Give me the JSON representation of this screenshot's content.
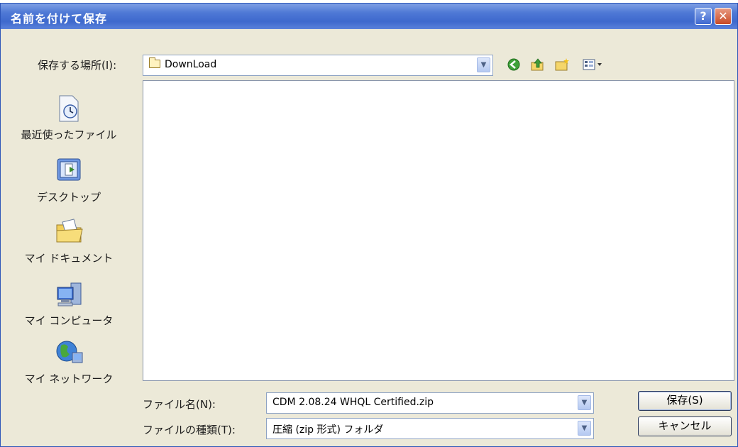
{
  "window": {
    "title": "名前を付けて保存",
    "help_label": "?",
    "close_label": "✕"
  },
  "save_in": {
    "label": "保存する場所(I):",
    "value": "DownLoad"
  },
  "toolbar": {
    "back_icon": "back-arrow-icon",
    "up_icon": "up-folder-icon",
    "new_folder_icon": "new-folder-icon",
    "views_icon": "views-menu-icon"
  },
  "places": [
    {
      "label": "最近使ったファイル",
      "icon": "recent-documents-icon"
    },
    {
      "label": "デスクトップ",
      "icon": "desktop-icon"
    },
    {
      "label": "マイ ドキュメント",
      "icon": "my-documents-icon"
    },
    {
      "label": "マイ コンピュータ",
      "icon": "my-computer-icon"
    },
    {
      "label": "マイ ネットワーク",
      "icon": "my-network-icon"
    }
  ],
  "file_name": {
    "label": "ファイル名(N):",
    "value": "CDM 2.08.24 WHQL Certified.zip"
  },
  "file_type": {
    "label": "ファイルの種類(T):",
    "value": "圧縮 (zip 形式) フォルダ"
  },
  "buttons": {
    "save": "保存(S)",
    "cancel": "キャンセル"
  },
  "colors": {
    "titlebar": "#3e69cd",
    "dialog_bg": "#ece9d8",
    "close_button": "#c94a25"
  }
}
